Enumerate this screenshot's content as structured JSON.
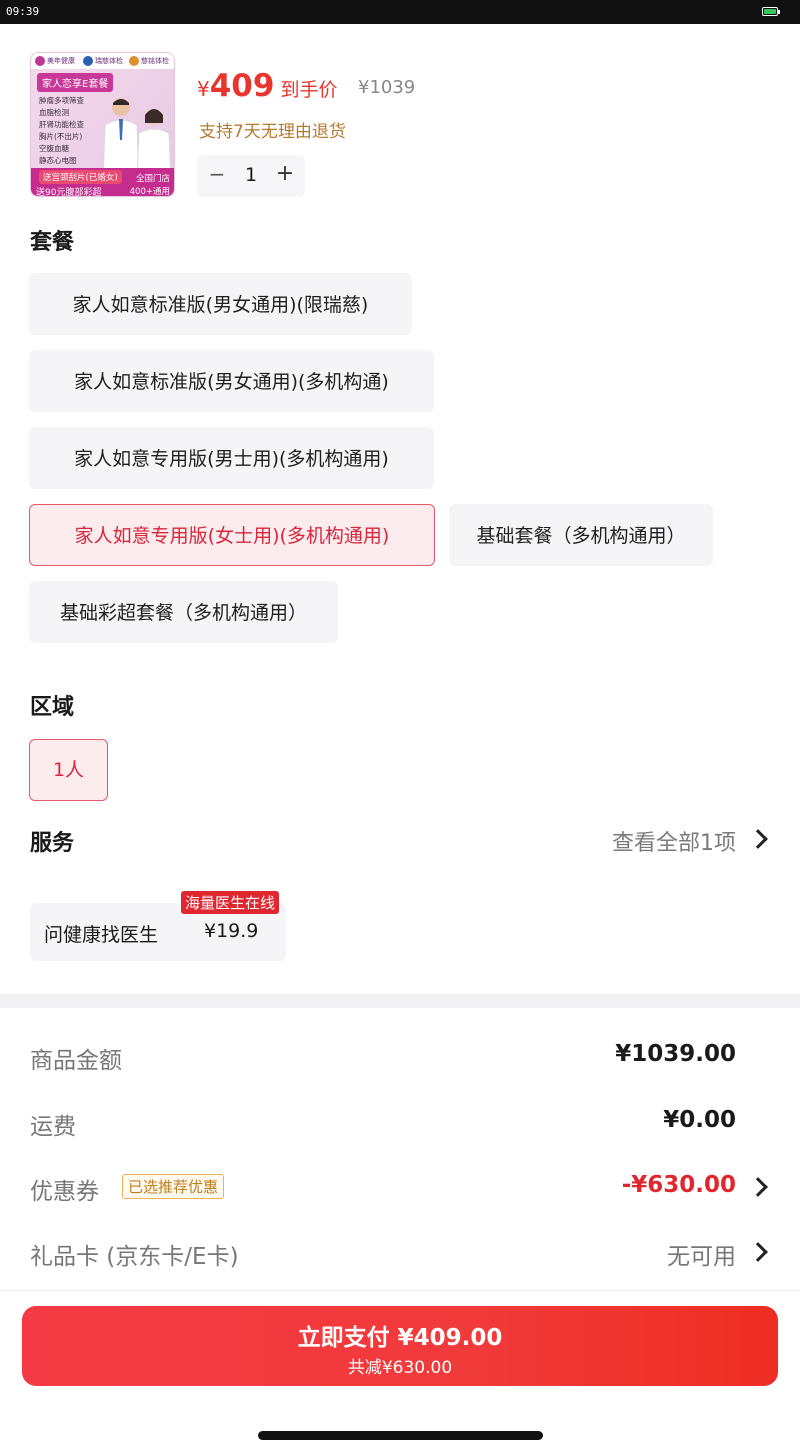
{
  "status_bar": {
    "time": "09:39"
  },
  "product": {
    "thumb": {
      "logos": [
        "美年健康",
        "瑞慈体检",
        "慈铭体检"
      ],
      "title": "家人恋享E套餐",
      "items": [
        "肿瘤多项筛查",
        "血脂检测",
        "肝肾功能检查",
        "胸片(不出片)",
        "空腹血糖",
        "静态心电图"
      ],
      "promo1": "送宫颈刮片(已婚女)",
      "promo2": "送90元腹部彩超",
      "stores1": "全国门店",
      "stores2": "400+通用"
    },
    "yen": "¥",
    "price": "409",
    "price_label": "到手价",
    "original_price": "¥1039",
    "return_policy": "支持7天无理由退货",
    "quantity": "1",
    "minus": "−",
    "plus": "+"
  },
  "package": {
    "title": "套餐",
    "options": [
      "家人如意标准版(男女通用)(限瑞慈)",
      "家人如意标准版(男女通用)(多机构通)",
      "家人如意专用版(男士用)(多机构通用)",
      "家人如意专用版(女士用)(多机构通用)",
      "基础套餐（多机构通用）",
      "基础彩超套餐（多机构通用）"
    ],
    "selected_index": 3
  },
  "region": {
    "title": "区域",
    "option": "1人"
  },
  "service": {
    "title": "服务",
    "view_all": "查看全部1项",
    "item_name": "问健康找医生",
    "item_price": "¥19.9",
    "badge": "海量医生在线"
  },
  "summary": {
    "goods_label": "商品金额",
    "goods_value": "¥1039.00",
    "shipping_label": "运费",
    "shipping_value": "¥0.00",
    "coupon_label": "优惠券",
    "coupon_tag": "已选推荐优惠",
    "coupon_value": "-¥630.00",
    "giftcard_label": "礼品卡 (京东卡/E卡)",
    "giftcard_value": "无可用"
  },
  "pay": {
    "main": "立即支付 ¥409.00",
    "sub": "共减¥630.00"
  },
  "colors": {
    "accent": "#e8362f",
    "selected_bg": "#fdecee",
    "return_text": "#b57a2e"
  }
}
